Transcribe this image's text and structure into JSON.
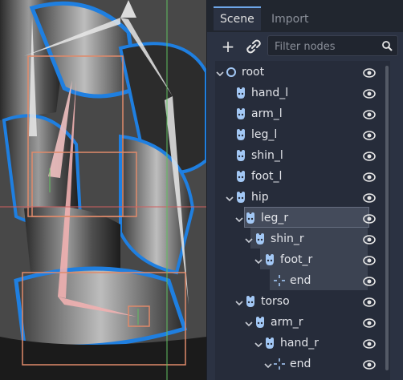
{
  "tabs": [
    {
      "label": "Scene"
    },
    {
      "label": "Import"
    }
  ],
  "toolbar": {
    "add_label": "+",
    "filter_placeholder": "Filter nodes"
  },
  "tree": [
    {
      "label": "root",
      "icon": "node-circle-icon",
      "depth": 0,
      "arrow": true
    },
    {
      "label": "hand_l",
      "icon": "bone-icon",
      "depth": 1,
      "arrow": false
    },
    {
      "label": "arm_l",
      "icon": "bone-icon",
      "depth": 1,
      "arrow": false
    },
    {
      "label": "leg_l",
      "icon": "bone-icon",
      "depth": 1,
      "arrow": false
    },
    {
      "label": "shin_l",
      "icon": "bone-icon",
      "depth": 1,
      "arrow": false
    },
    {
      "label": "foot_l",
      "icon": "bone-icon",
      "depth": 1,
      "arrow": false
    },
    {
      "label": "hip",
      "icon": "bone-icon",
      "depth": 1,
      "arrow": true
    },
    {
      "label": "leg_r",
      "icon": "bone-icon",
      "depth": 2,
      "arrow": true
    },
    {
      "label": "shin_r",
      "icon": "bone-icon",
      "depth": 3,
      "arrow": true
    },
    {
      "label": "foot_r",
      "icon": "bone-icon",
      "depth": 4,
      "arrow": true
    },
    {
      "label": "end",
      "icon": "position-icon",
      "depth": 5,
      "arrow": false
    },
    {
      "label": "torso",
      "icon": "bone-icon",
      "depth": 2,
      "arrow": true
    },
    {
      "label": "arm_r",
      "icon": "bone-icon",
      "depth": 3,
      "arrow": true
    },
    {
      "label": "hand_r",
      "icon": "bone-icon",
      "depth": 4,
      "arrow": true
    },
    {
      "label": "end",
      "icon": "position-icon",
      "depth": 5,
      "arrow": true
    }
  ],
  "colors": {
    "accent": "#6ea6e8",
    "bone": "#a3c8f5",
    "panel": "#2b3242"
  }
}
